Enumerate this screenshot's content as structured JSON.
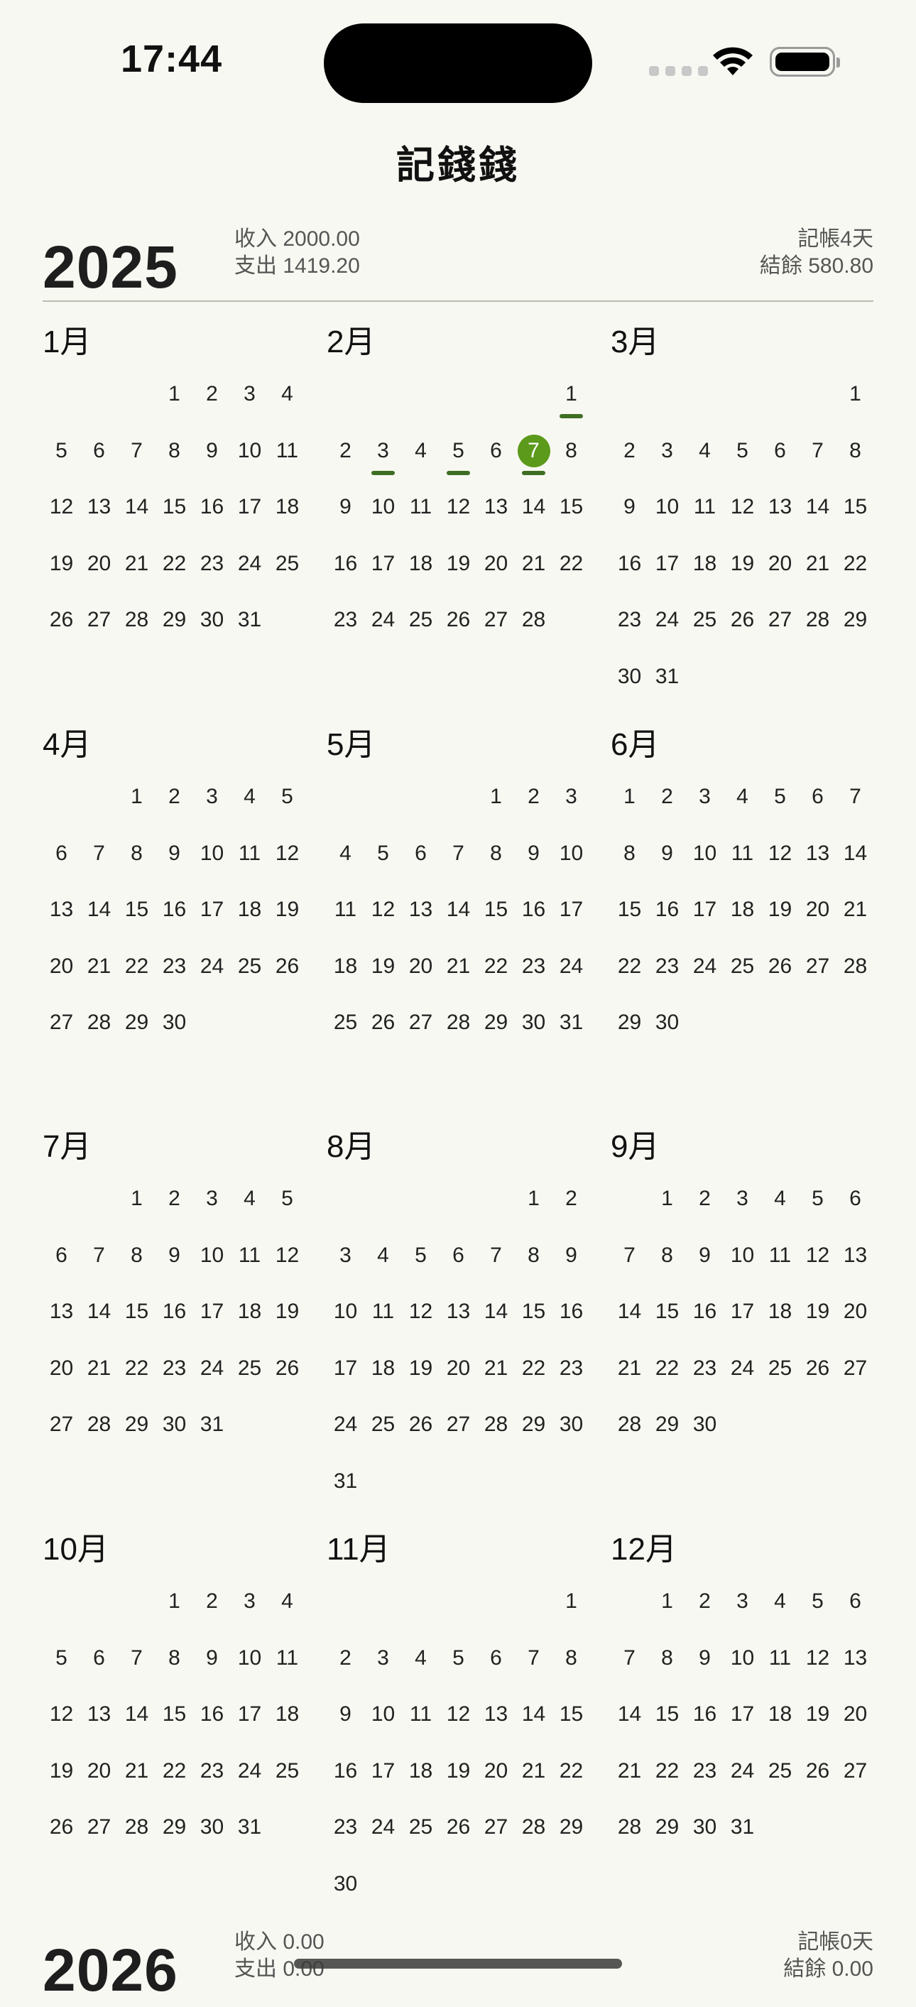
{
  "status_bar": {
    "time": "17:44"
  },
  "app_title": "記錢錢",
  "years": [
    {
      "year": "2025",
      "income": "收入 2000.00",
      "expense": "支出 1419.20",
      "days_recorded": "記帳4天",
      "balance": "結餘 580.80",
      "today_day": 7,
      "today_month": 2,
      "recorded_days": [
        {
          "month": 2,
          "day": 1
        },
        {
          "month": 2,
          "day": 3
        },
        {
          "month": 2,
          "day": 5
        },
        {
          "month": 2,
          "day": 7
        }
      ],
      "months": [
        {
          "name": "1月",
          "offset": 3,
          "days": 31
        },
        {
          "name": "2月",
          "offset": 6,
          "days": 28
        },
        {
          "name": "3月",
          "offset": 6,
          "days": 31
        },
        {
          "name": "4月",
          "offset": 2,
          "days": 30
        },
        {
          "name": "5月",
          "offset": 4,
          "days": 31
        },
        {
          "name": "6月",
          "offset": 0,
          "days": 30
        },
        {
          "name": "7月",
          "offset": 2,
          "days": 31
        },
        {
          "name": "8月",
          "offset": 5,
          "days": 31
        },
        {
          "name": "9月",
          "offset": 1,
          "days": 30
        },
        {
          "name": "10月",
          "offset": 3,
          "days": 31
        },
        {
          "name": "11月",
          "offset": 6,
          "days": 30
        },
        {
          "name": "12月",
          "offset": 1,
          "days": 31
        }
      ]
    },
    {
      "year": "2026",
      "income": "收入 0.00",
      "expense": "支出 0.00",
      "days_recorded": "記帳0天",
      "balance": "結餘 0.00"
    }
  ]
}
